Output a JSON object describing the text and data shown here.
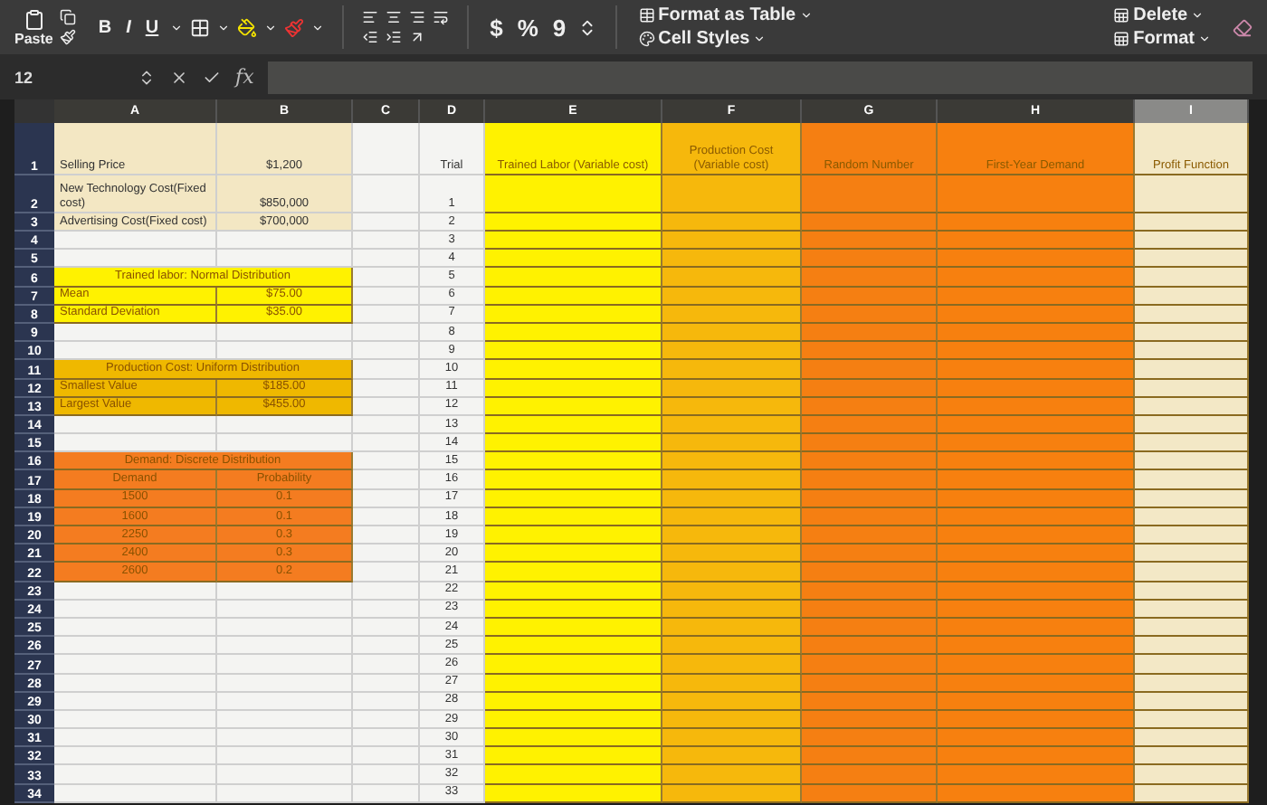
{
  "ribbon": {
    "paste": "Paste",
    "font_buttons": [
      "B",
      "I",
      "U"
    ],
    "number_buttons": [
      "$",
      "%",
      "9"
    ],
    "styles": [
      "Format as Table",
      "Cell Styles"
    ],
    "cells": [
      "Delete",
      "Format"
    ]
  },
  "formula_bar": {
    "name_box": "12",
    "function_label": "fx"
  },
  "columns": [
    {
      "letter": "A",
      "selected": false
    },
    {
      "letter": "B",
      "selected": false
    },
    {
      "letter": "C",
      "selected": false
    },
    {
      "letter": "D",
      "selected": false
    },
    {
      "letter": "E",
      "selected": false,
      "header": "Trained Labor (Variable cost)",
      "color": "#fff200"
    },
    {
      "letter": "F",
      "selected": false,
      "header": "Production Cost (Variable cost)",
      "color": "#f6b80c"
    },
    {
      "letter": "G",
      "selected": false,
      "header": "Random Number",
      "color": "#f57f12"
    },
    {
      "letter": "H",
      "selected": false,
      "header": "First-Year Demand",
      "color": "#f7800f"
    },
    {
      "letter": "I",
      "selected": true,
      "header": "Profit Function",
      "color": "#f3e8c6"
    }
  ],
  "row_numbers": [
    "1",
    "2",
    "3",
    "4",
    "5",
    "6",
    "7",
    "8",
    "9",
    "10",
    "11",
    "12",
    "13",
    "14",
    "15",
    "16",
    "17",
    "18",
    "19",
    "20",
    "21",
    "22",
    "23",
    "24",
    "25",
    "26",
    "27",
    "28",
    "29",
    "30",
    "31",
    "32",
    "33",
    "34"
  ],
  "blocks": [
    {
      "kind": "pairs",
      "color": "#f3e7c3",
      "rows": [
        {
          "label": "Selling Price",
          "value": "$1,200"
        },
        {
          "label": "New Technology Cost(Fixed cost)",
          "value": "$850,000"
        },
        {
          "label": "Advertising Cost(Fixed cost)",
          "value": "$700,000"
        }
      ]
    },
    {
      "kind": "pairs",
      "title": "Trained labor: Normal Distribution",
      "color": "#fff200",
      "rows": [
        {
          "label": "Mean",
          "value": "$75.00"
        },
        {
          "label": "Standard Deviation",
          "value": "$35.00"
        }
      ]
    },
    {
      "kind": "pairs",
      "title": "Production Cost: Uniform Distribution",
      "color": "#efb800",
      "rows": [
        {
          "label": "Smallest Value",
          "value": "$185.00"
        },
        {
          "label": "Largest Value",
          "value": "$455.00"
        }
      ]
    },
    {
      "kind": "table",
      "title": "Demand: Discrete Distribution",
      "color": "#f47c20",
      "columns": [
        "Demand",
        "Probability"
      ],
      "rows": [
        {
          "label": "1500",
          "value": "0.1"
        },
        {
          "label": "1600",
          "value": "0.1"
        },
        {
          "label": "2250",
          "value": "0.3"
        },
        {
          "label": "2400",
          "value": "0.3"
        },
        {
          "label": "2600",
          "value": "0.2"
        }
      ]
    }
  ],
  "trial_label": "Trial",
  "trials": [
    "1",
    "2",
    "3",
    "4",
    "5",
    "6",
    "7",
    "8",
    "9",
    "10",
    "11",
    "12",
    "13",
    "14",
    "15",
    "16",
    "17",
    "18",
    "19",
    "20",
    "21",
    "22",
    "23",
    "24",
    "25",
    "26",
    "27",
    "28",
    "29",
    "30",
    "31",
    "32",
    "33"
  ]
}
